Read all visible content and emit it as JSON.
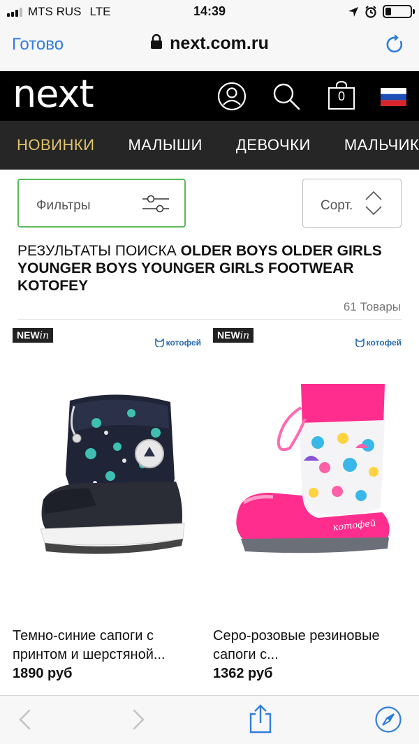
{
  "status_bar": {
    "carrier": "MTS RUS",
    "network": "LTE",
    "time": "14:39"
  },
  "browser": {
    "done_label": "Готово",
    "url": "next.com.ru"
  },
  "site_header": {
    "logo": "next",
    "bag_count": "0"
  },
  "categories": [
    {
      "label": "НОВИНКИ",
      "active": true
    },
    {
      "label": "МАЛЫШИ",
      "active": false
    },
    {
      "label": "ДЕВОЧКИ",
      "active": false
    },
    {
      "label": "МАЛЬЧИКИ",
      "active": false
    }
  ],
  "controls": {
    "filter_label": "Фильтры",
    "sort_label": "Сорт."
  },
  "results": {
    "prefix": "РЕЗУЛЬТАТЫ ПОИСКА ",
    "query": "OLDER BOYS OLDER GIRLS YOUNGER BOYS YOUNGER GIRLS FOOTWEAR KOTOFEY",
    "count": "61 Товары"
  },
  "products": [
    {
      "badge_main": "NEW",
      "badge_suffix": "in",
      "brand": "котофей",
      "name": "Темно-синие сапоги с принтом и шерстяной...",
      "price": "1890 руб"
    },
    {
      "badge_main": "NEW",
      "badge_suffix": "in",
      "brand": "котофей",
      "name": "Серо-розовые резиновые сапоги с...",
      "price": "1362 руб",
      "boot_print": "котофей"
    }
  ],
  "colors": {
    "ios_blue": "#2f7ddc",
    "filter_border": "#5cb85c",
    "active_category": "#e0c36e",
    "header_bg": "#000000",
    "nav_bg": "#262626"
  },
  "icons": [
    "signal-icon",
    "location-icon",
    "alarm-icon",
    "battery-icon",
    "lock-icon",
    "reload-icon",
    "account-icon",
    "search-icon",
    "bag-icon",
    "russia-flag-icon",
    "filter-sliders-icon",
    "sort-arrows-icon",
    "back-icon",
    "forward-icon",
    "share-icon",
    "compass-icon"
  ]
}
